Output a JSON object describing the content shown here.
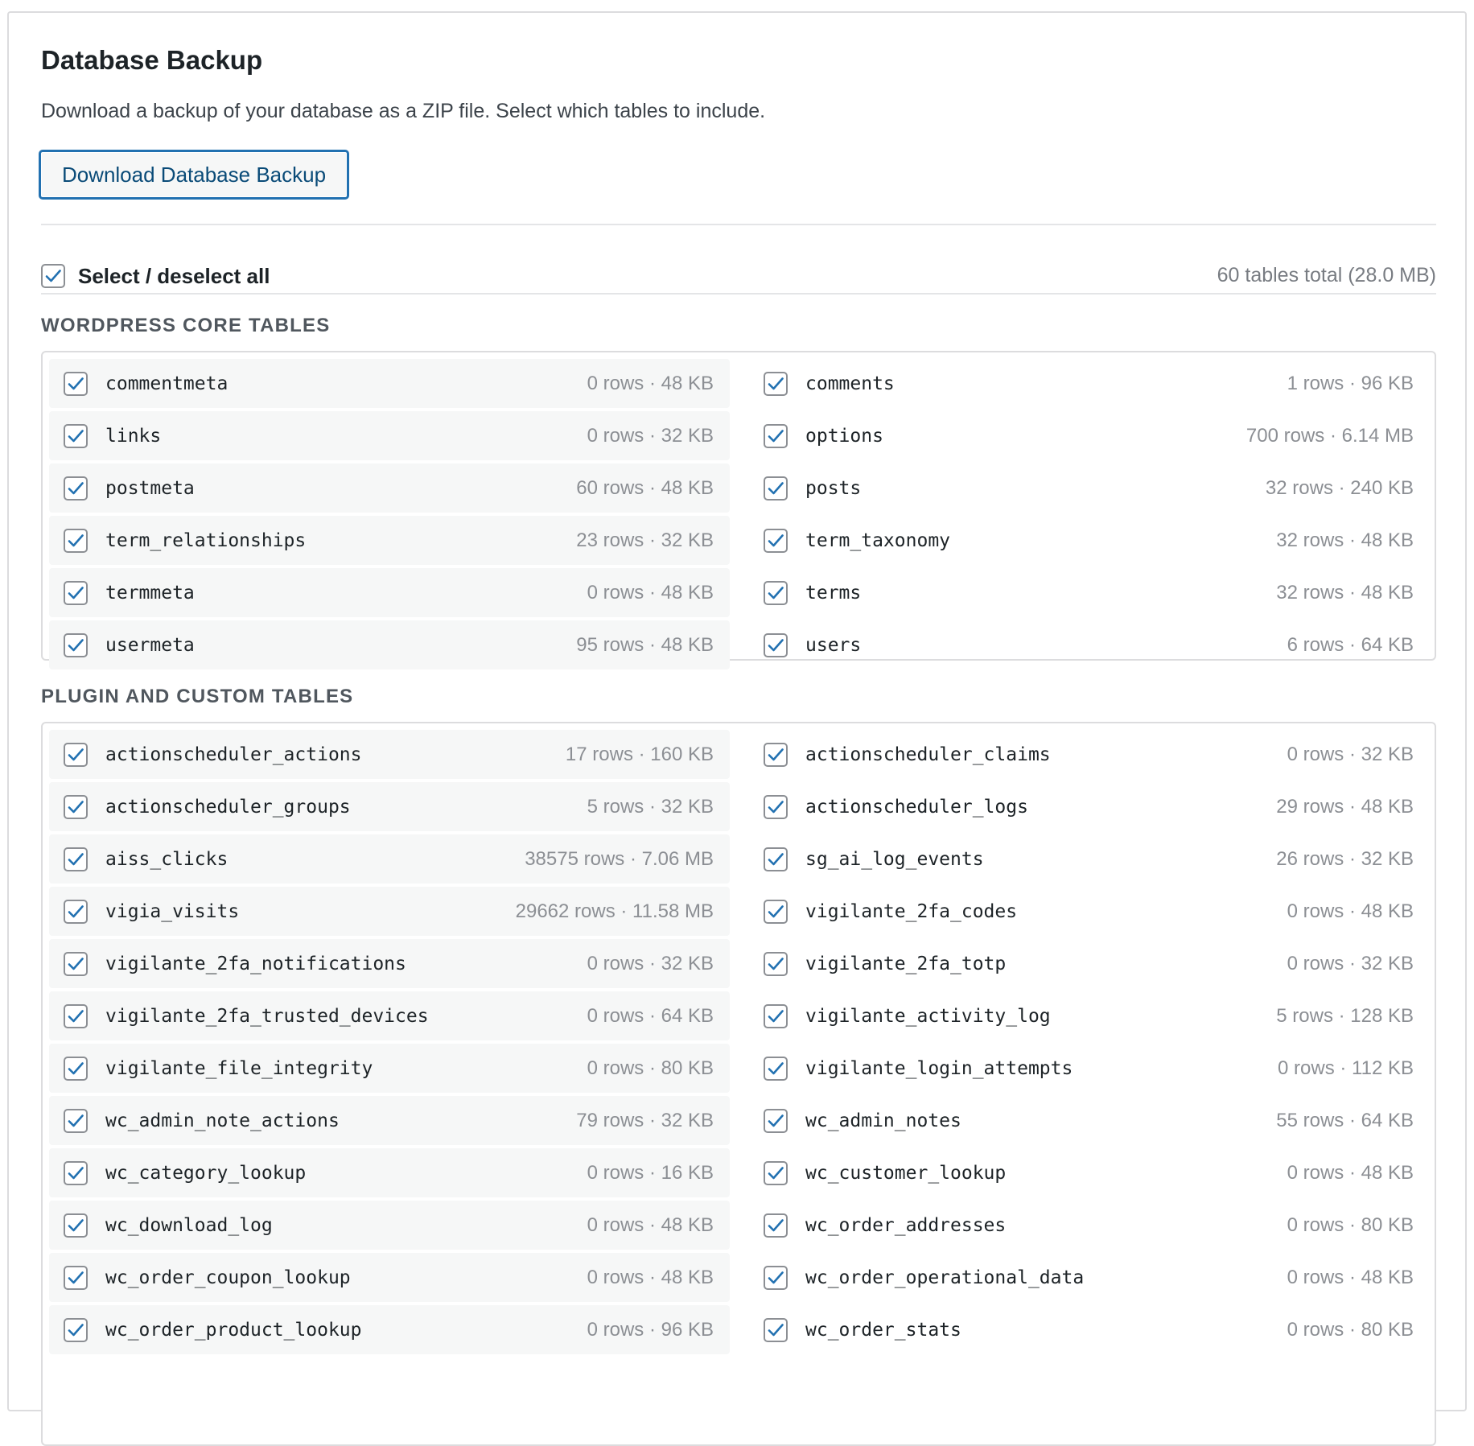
{
  "header": {
    "title": "Database Backup",
    "description": "Download a backup of your database as a ZIP file. Select which tables to include.",
    "download_label": "Download Database Backup"
  },
  "select_all": {
    "label": "Select / deselect all",
    "checked": true,
    "total": "60 tables total (28.0 MB)"
  },
  "sections": [
    {
      "heading": "WordPress Core Tables",
      "tables": [
        {
          "name": "commentmeta",
          "meta": "0 rows · 48 KB",
          "checked": true
        },
        {
          "name": "comments",
          "meta": "1 rows · 96 KB",
          "checked": true
        },
        {
          "name": "links",
          "meta": "0 rows · 32 KB",
          "checked": true
        },
        {
          "name": "options",
          "meta": "700 rows · 6.14 MB",
          "checked": true
        },
        {
          "name": "postmeta",
          "meta": "60 rows · 48 KB",
          "checked": true
        },
        {
          "name": "posts",
          "meta": "32 rows · 240 KB",
          "checked": true
        },
        {
          "name": "term_relationships",
          "meta": "23 rows · 32 KB",
          "checked": true
        },
        {
          "name": "term_taxonomy",
          "meta": "32 rows · 48 KB",
          "checked": true
        },
        {
          "name": "termmeta",
          "meta": "0 rows · 48 KB",
          "checked": true
        },
        {
          "name": "terms",
          "meta": "32 rows · 48 KB",
          "checked": true
        },
        {
          "name": "usermeta",
          "meta": "95 rows · 48 KB",
          "checked": true
        },
        {
          "name": "users",
          "meta": "6 rows · 64 KB",
          "checked": true
        }
      ]
    },
    {
      "heading": "Plugin and Custom Tables",
      "tables": [
        {
          "name": "actionscheduler_actions",
          "meta": "17 rows · 160 KB",
          "checked": true
        },
        {
          "name": "actionscheduler_claims",
          "meta": "0 rows · 32 KB",
          "checked": true
        },
        {
          "name": "actionscheduler_groups",
          "meta": "5 rows · 32 KB",
          "checked": true
        },
        {
          "name": "actionscheduler_logs",
          "meta": "29 rows · 48 KB",
          "checked": true
        },
        {
          "name": "aiss_clicks",
          "meta": "38575 rows · 7.06 MB",
          "checked": true
        },
        {
          "name": "sg_ai_log_events",
          "meta": "26 rows · 32 KB",
          "checked": true
        },
        {
          "name": "vigia_visits",
          "meta": "29662 rows · 11.58 MB",
          "checked": true
        },
        {
          "name": "vigilante_2fa_codes",
          "meta": "0 rows · 48 KB",
          "checked": true
        },
        {
          "name": "vigilante_2fa_notifications",
          "meta": "0 rows · 32 KB",
          "checked": true
        },
        {
          "name": "vigilante_2fa_totp",
          "meta": "0 rows · 32 KB",
          "checked": true
        },
        {
          "name": "vigilante_2fa_trusted_devices",
          "meta": "0 rows · 64 KB",
          "checked": true
        },
        {
          "name": "vigilante_activity_log",
          "meta": "5 rows · 128 KB",
          "checked": true
        },
        {
          "name": "vigilante_file_integrity",
          "meta": "0 rows · 80 KB",
          "checked": true
        },
        {
          "name": "vigilante_login_attempts",
          "meta": "0 rows · 112 KB",
          "checked": true
        },
        {
          "name": "wc_admin_note_actions",
          "meta": "79 rows · 32 KB",
          "checked": true
        },
        {
          "name": "wc_admin_notes",
          "meta": "55 rows · 64 KB",
          "checked": true
        },
        {
          "name": "wc_category_lookup",
          "meta": "0 rows · 16 KB",
          "checked": true
        },
        {
          "name": "wc_customer_lookup",
          "meta": "0 rows · 48 KB",
          "checked": true
        },
        {
          "name": "wc_download_log",
          "meta": "0 rows · 48 KB",
          "checked": true
        },
        {
          "name": "wc_order_addresses",
          "meta": "0 rows · 80 KB",
          "checked": true
        },
        {
          "name": "wc_order_coupon_lookup",
          "meta": "0 rows · 48 KB",
          "checked": true
        },
        {
          "name": "wc_order_operational_data",
          "meta": "0 rows · 48 KB",
          "checked": true
        },
        {
          "name": "wc_order_product_lookup",
          "meta": "0 rows · 96 KB",
          "checked": true
        },
        {
          "name": "wc_order_stats",
          "meta": "0 rows · 80 KB",
          "checked": true
        }
      ]
    }
  ],
  "colors": {
    "accent": "#2271b1",
    "check": "#2271b1",
    "border": "#dcdcde",
    "row_shade": "#f6f7f7"
  }
}
